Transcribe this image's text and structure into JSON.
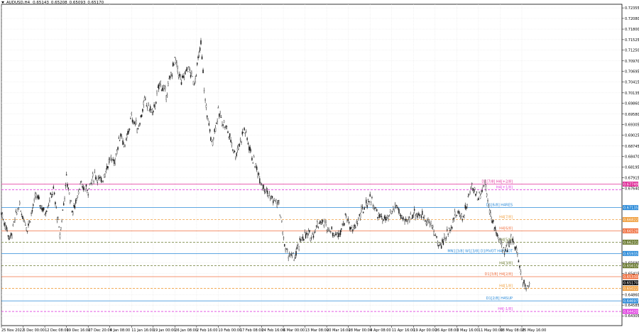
{
  "header": {
    "symbol": "AUDUSD,H4",
    "open": "0.65143",
    "high": "0.65208",
    "low": "0.65093",
    "close": "0.65170"
  },
  "price_axis": {
    "ticks": [
      "0.72355",
      "0.72080",
      "0.71800",
      "0.71525",
      "0.71250",
      "0.70970",
      "0.70695",
      "0.70415",
      "0.70135",
      "0.69860",
      "0.69580",
      "0.69305",
      "0.69025",
      "0.68745",
      "0.68470",
      "0.68195",
      "0.67915",
      "0.67640",
      "0.65690",
      "0.65415",
      "0.64860",
      "0.64585",
      "0.64305"
    ]
  },
  "time_axis": {
    "ticks": [
      "25 Nov 2022",
      "5 Dec 00:00",
      "12 Dec 08:00",
      "19 Dec 16:00",
      "27 Dec 20:00",
      "4 Jan 08:00",
      "11 Jan 16:00",
      "19 Jan 00:00",
      "26 Jan 08:00",
      "2 Feb 16:00",
      "10 Feb 00:00",
      "17 Feb 08:00",
      "24 Feb 16:00",
      "6 Mar 00:00",
      "13 Mar 08:00",
      "20 Mar 16:00",
      "28 Mar 00:00",
      "4 Apr 08:00",
      "11 Apr 16:00",
      "19 Apr 00:00",
      "26 Apr 08:00",
      "3 May 16:00",
      "11 May 00:00",
      "18 May 08:00",
      "25 May 16:00"
    ]
  },
  "levels": [
    {
      "label": "D1[7/8] H4[+2/8]",
      "price": "0.67749",
      "color": "#e0309a",
      "style": "solid"
    },
    {
      "label": "H4[+1/8]",
      "price": "",
      "color": "#e040e0",
      "style": "dashed"
    },
    {
      "label": "D1[6/8] H4RES",
      "price": "0.67135",
      "color": "#2a8ad8",
      "style": "solid"
    },
    {
      "label": "H4[7/8]",
      "price": "0.66822",
      "color": "#f0a040",
      "style": "dashed"
    },
    {
      "label": "H4[6/8]",
      "price": "0.66528",
      "color": "#f07040",
      "style": "solid"
    },
    {
      "label": "H4[5/8]",
      "price": "0.66231",
      "color": "#6a7a30",
      "style": "dashed"
    },
    {
      "label": "MN1[3/8] W1[3/8] D1PIVOT H4PIVOT",
      "price": "0.65935",
      "color": "#2a8ad8",
      "style": "solid"
    },
    {
      "label": "H4[3/8]",
      "price": "0.65615",
      "color": "#6a7a30",
      "style": "dashed"
    },
    {
      "label": "D1[3/8] H4[2/8]",
      "price": "0.65330",
      "color": "#f07040",
      "style": "solid"
    },
    {
      "label": "",
      "price": "0.65170",
      "color": "#111111",
      "style": "none"
    },
    {
      "label": "H4[1/8]",
      "price": "0.65022",
      "color": "#f0a040",
      "style": "dashed"
    },
    {
      "label": "D1[2/8] H4SUP",
      "price": "0.64697",
      "color": "#2a8ad8",
      "style": "solid"
    },
    {
      "label": "H4[-1/8]",
      "price": "0.64420",
      "color": "#e040e0",
      "style": "dashed"
    }
  ],
  "chart_data": {
    "type": "line",
    "series_style": "candles",
    "x": [
      "25 Nov 2022",
      "5 Dec 00:00",
      "12 Dec 08:00",
      "19 Dec 16:00",
      "27 Dec 20:00",
      "4 Jan 08:00",
      "11 Jan 16:00",
      "19 Jan 00:00",
      "26 Jan 08:00",
      "2 Feb 16:00",
      "10 Feb 00:00",
      "17 Feb 08:00",
      "24 Feb 16:00",
      "6 Mar 00:00",
      "13 Mar 08:00",
      "20 Mar 16:00",
      "28 Mar 00:00",
      "4 Apr 08:00",
      "11 Apr 16:00",
      "19 Apr 00:00",
      "26 Apr 08:00",
      "3 May 16:00",
      "11 May 00:00",
      "18 May 08:00",
      "25 May 16:00"
    ],
    "price_path": [
      [
        0,
        0.67
      ],
      [
        0.4,
        0.663
      ],
      [
        0.8,
        0.672
      ],
      [
        1.2,
        0.666
      ],
      [
        1.6,
        0.6745
      ],
      [
        2.0,
        0.67
      ],
      [
        2.4,
        0.676
      ],
      [
        2.7,
        0.664
      ],
      [
        3.0,
        0.679
      ],
      [
        3.3,
        0.67
      ],
      [
        3.6,
        0.677
      ],
      [
        4.0,
        0.676
      ],
      [
        4.3,
        0.68
      ],
      [
        4.6,
        0.678
      ],
      [
        5.0,
        0.684
      ],
      [
        5.2,
        0.683
      ],
      [
        5.5,
        0.691
      ],
      [
        5.7,
        0.687
      ],
      [
        6.0,
        0.695
      ],
      [
        6.3,
        0.692
      ],
      [
        6.6,
        0.699
      ],
      [
        7.0,
        0.696
      ],
      [
        7.3,
        0.704
      ],
      [
        7.6,
        0.701
      ],
      [
        8.0,
        0.71
      ],
      [
        8.3,
        0.704
      ],
      [
        8.6,
        0.708
      ],
      [
        8.9,
        0.704
      ],
      [
        9.2,
        0.714
      ],
      [
        9.4,
        0.699
      ],
      [
        9.7,
        0.688
      ],
      [
        10.0,
        0.696
      ],
      [
        10.4,
        0.692
      ],
      [
        10.8,
        0.685
      ],
      [
        11.2,
        0.692
      ],
      [
        11.6,
        0.684
      ],
      [
        12.0,
        0.678
      ],
      [
        12.4,
        0.674
      ],
      [
        12.8,
        0.672
      ],
      [
        13.1,
        0.66
      ],
      [
        13.5,
        0.658
      ],
      [
        13.9,
        0.664
      ],
      [
        14.3,
        0.664
      ],
      [
        14.7,
        0.668
      ],
      [
        15.1,
        0.666
      ],
      [
        15.5,
        0.664
      ],
      [
        15.9,
        0.669
      ],
      [
        16.2,
        0.665
      ],
      [
        16.6,
        0.67
      ],
      [
        17.0,
        0.674
      ],
      [
        17.4,
        0.669
      ],
      [
        17.8,
        0.668
      ],
      [
        18.2,
        0.672
      ],
      [
        18.6,
        0.667
      ],
      [
        19.0,
        0.67
      ],
      [
        19.5,
        0.669
      ],
      [
        19.9,
        0.666
      ],
      [
        20.2,
        0.661
      ],
      [
        20.6,
        0.665
      ],
      [
        21.0,
        0.67
      ],
      [
        21.3,
        0.669
      ],
      [
        21.7,
        0.677
      ],
      [
        22.0,
        0.674
      ],
      [
        22.3,
        0.678
      ],
      [
        22.6,
        0.668
      ],
      [
        22.9,
        0.664
      ],
      [
        23.2,
        0.659
      ],
      [
        23.5,
        0.664
      ],
      [
        23.8,
        0.659
      ],
      [
        24.0,
        0.653
      ],
      [
        24.2,
        0.6505
      ],
      [
        24.4,
        0.6517
      ]
    ],
    "last_price": "0.65170",
    "ylim": [
      0.6405,
      0.7245
    ]
  }
}
